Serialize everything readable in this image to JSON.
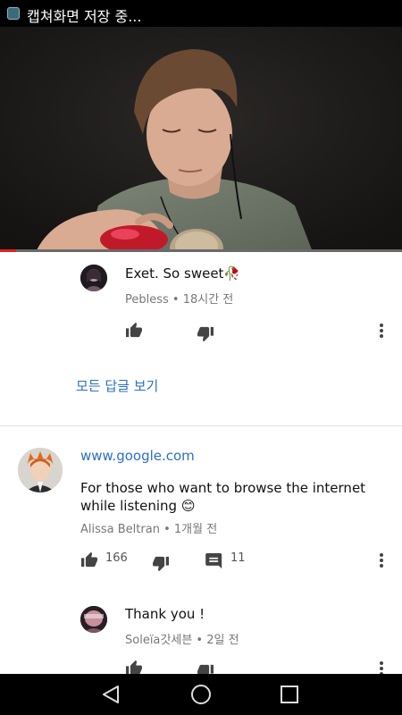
{
  "status_bar": {
    "text": "캡쳐화면 저장 중..."
  },
  "video": {
    "progress_fraction": 0.04,
    "colors": {
      "progress": "#e62117"
    }
  },
  "replies_top": {
    "text": "Exet. So sweet🥀",
    "author": "Pebless",
    "time": "18시간 전",
    "meta": "Pebless • 18시간 전"
  },
  "view_all_replies": "모든 답글 보기",
  "main_comment": {
    "link": "www.google.com",
    "text": "For those who want to browse the internet while listening 😊",
    "meta": "Alissa Beltran • 1개월 전",
    "likes": "166",
    "replies": "11"
  },
  "reply_2": {
    "text": "Thank you !",
    "meta": "Soleïa갓세븐 • 2일 전"
  },
  "colors": {
    "link": "#2a6fc9",
    "meta": "#777777"
  }
}
